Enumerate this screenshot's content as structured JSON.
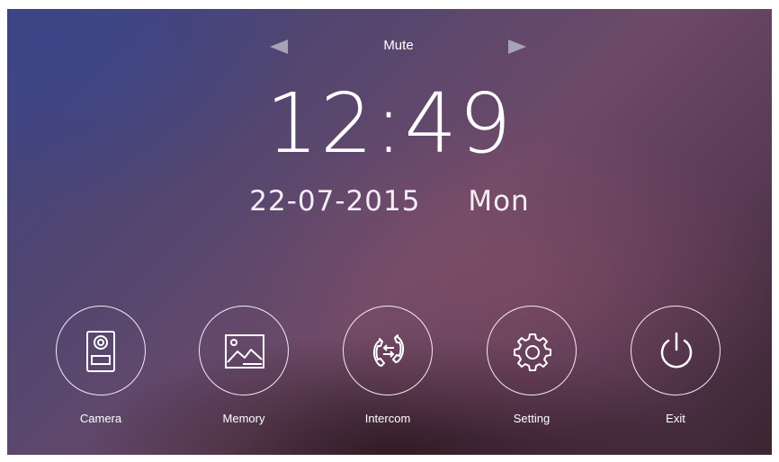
{
  "header": {
    "mode_label": "Mute",
    "prev_icon": "triangle-left-icon",
    "next_icon": "triangle-right-icon"
  },
  "clock": {
    "time": "12:49",
    "date": "22-07-2015",
    "weekday": "Mon"
  },
  "menu": {
    "items": [
      {
        "label": "Camera",
        "icon": "doorbell-camera-icon"
      },
      {
        "label": "Memory",
        "icon": "picture-icon"
      },
      {
        "label": "Intercom",
        "icon": "intercom-phones-icon"
      },
      {
        "label": "Setting",
        "icon": "gear-icon"
      },
      {
        "label": "Exit",
        "icon": "power-icon"
      }
    ]
  },
  "colors": {
    "text": "#ffffff",
    "arrow": "#a7a2b5",
    "background_dark": "#3a2530",
    "background_blue": "#3d4380",
    "background_mauve": "#6d4a68"
  }
}
